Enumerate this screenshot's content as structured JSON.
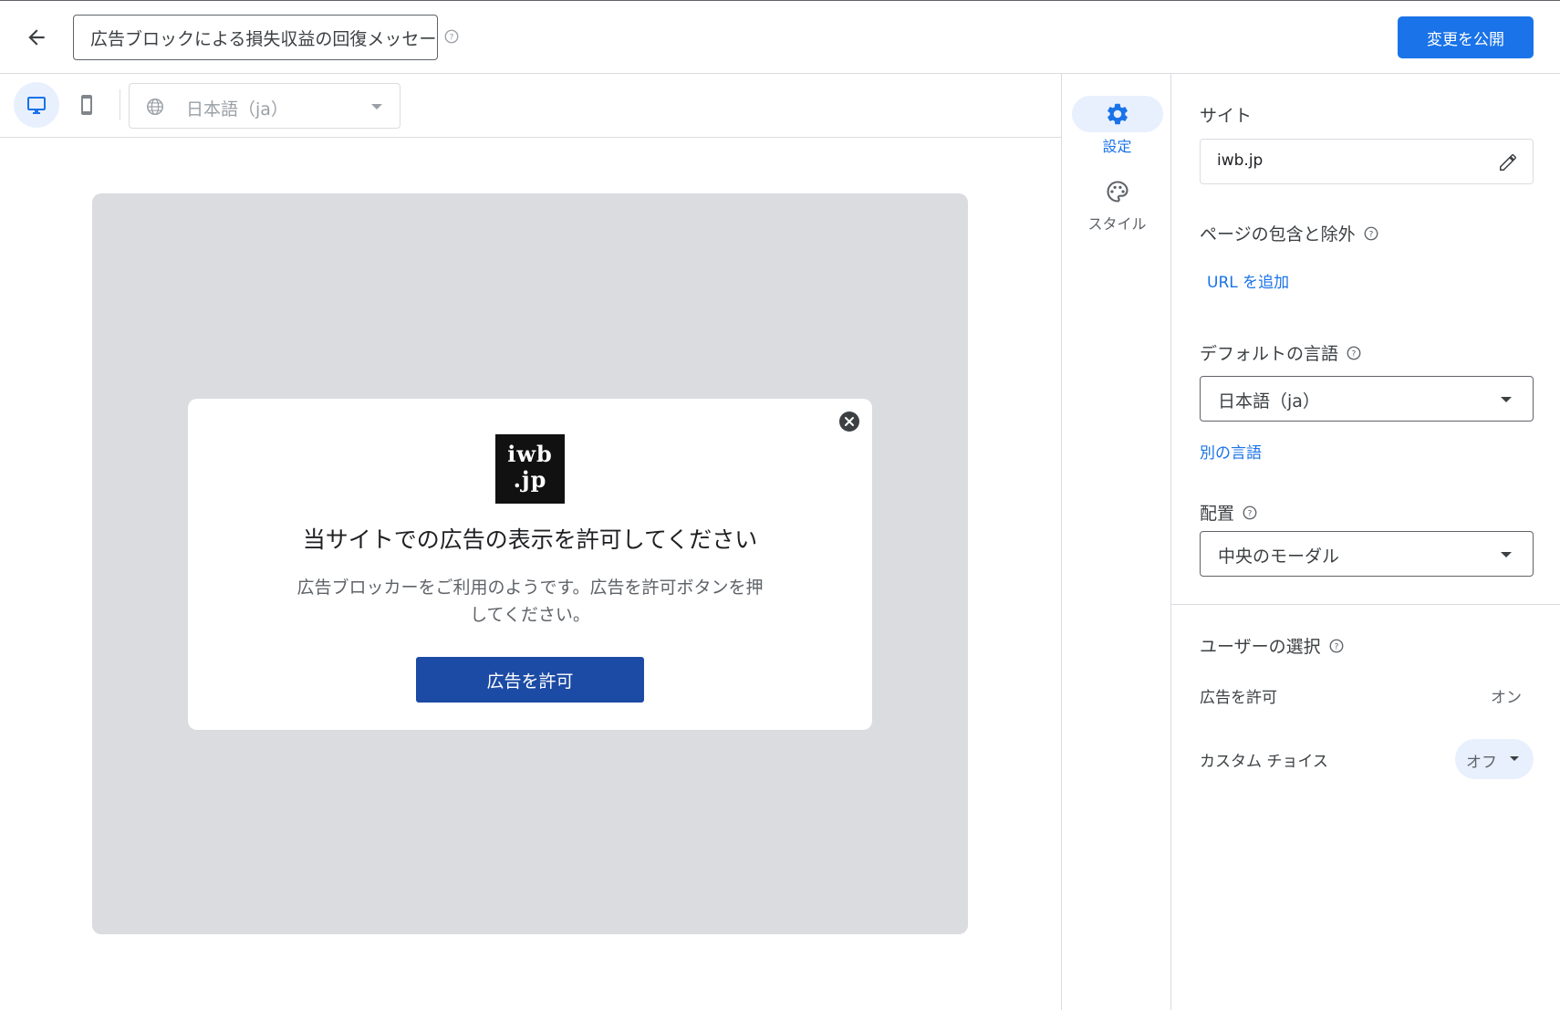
{
  "header": {
    "title_value": "広告ブロックによる損失収益の回復メッセージ",
    "publish_label": "変更を公開"
  },
  "canvas": {
    "language_select": "日本語（ja）"
  },
  "preview": {
    "logo_line1": "iwb",
    "logo_line2": ".jp",
    "title": "当サイトでの広告の表示を許可してください",
    "body": "広告ブロッカーをご利用のようです。広告を許可ボタンを押してください。",
    "button_label": "広告を許可"
  },
  "rail": {
    "items": [
      {
        "label": "設定",
        "icon": "gear-icon",
        "active": true
      },
      {
        "label": "スタイル",
        "icon": "palette-icon",
        "active": false
      }
    ]
  },
  "panel": {
    "site_title": "サイト",
    "site_value": "iwb.jp",
    "pages_title": "ページの包含と除外",
    "add_url_link": "URL を追加",
    "default_lang_title": "デフォルトの言語",
    "default_lang_value": "日本語（ja）",
    "other_lang_link": "別の言語",
    "placement_title": "配置",
    "placement_value": "中央のモーダル",
    "user_choice_title": "ユーザーの選択",
    "allow_ads_label": "広告を許可",
    "allow_ads_value": "オン",
    "custom_choice_label": "カスタム チョイス",
    "custom_choice_value": "オフ"
  },
  "colors": {
    "accent": "#1a73e8",
    "modal_button": "#1c4ba5",
    "preview_background": "#dadce0"
  }
}
